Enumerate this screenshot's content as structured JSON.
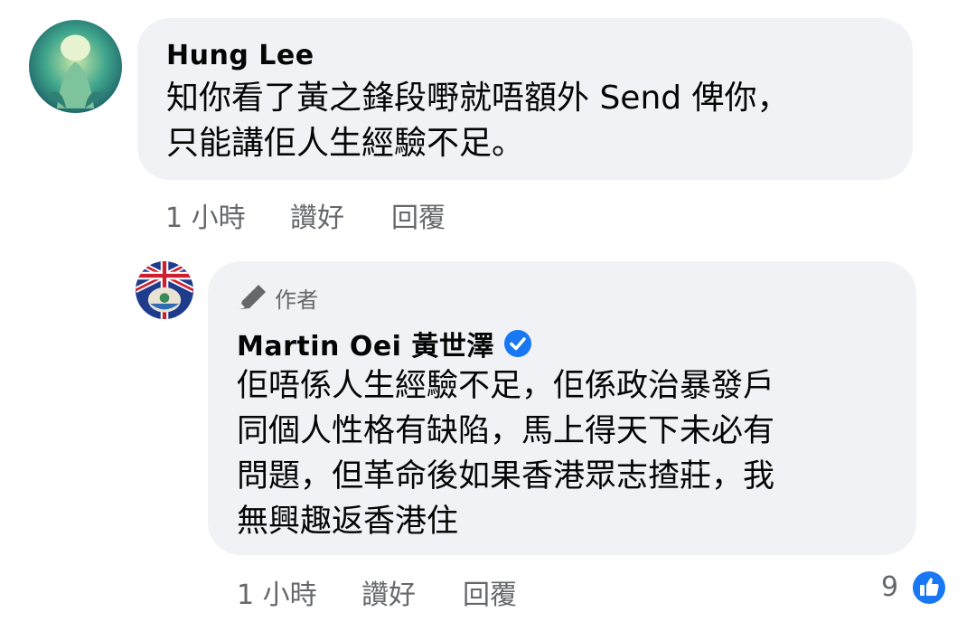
{
  "comment1": {
    "name": "Hung  Lee",
    "text_line1": "知你看了黃之鋒段嘢就唔額外 Send 俾你，",
    "text_line2": "只能講佢人生經驗不足。",
    "time": "1 小時",
    "like": "讚好",
    "reply": "回覆"
  },
  "comment2": {
    "author_badge": "作者",
    "name": "Martin Oei 黃世澤",
    "text_lines": [
      "佢唔係人生經驗不足，佢係政治暴發戶",
      "同個人性格有缺陷，馬上得天下未必有",
      "問題，但革命後如果香港眾志揸莊，我",
      "無興趣返香港住"
    ],
    "time": "1 小時",
    "like": "讚好",
    "reply": "回覆",
    "reaction_count": "9"
  },
  "colors": {
    "bubble": "#f0f2f5",
    "meta_text": "#65676b",
    "accent_blue": "#1877f2"
  }
}
